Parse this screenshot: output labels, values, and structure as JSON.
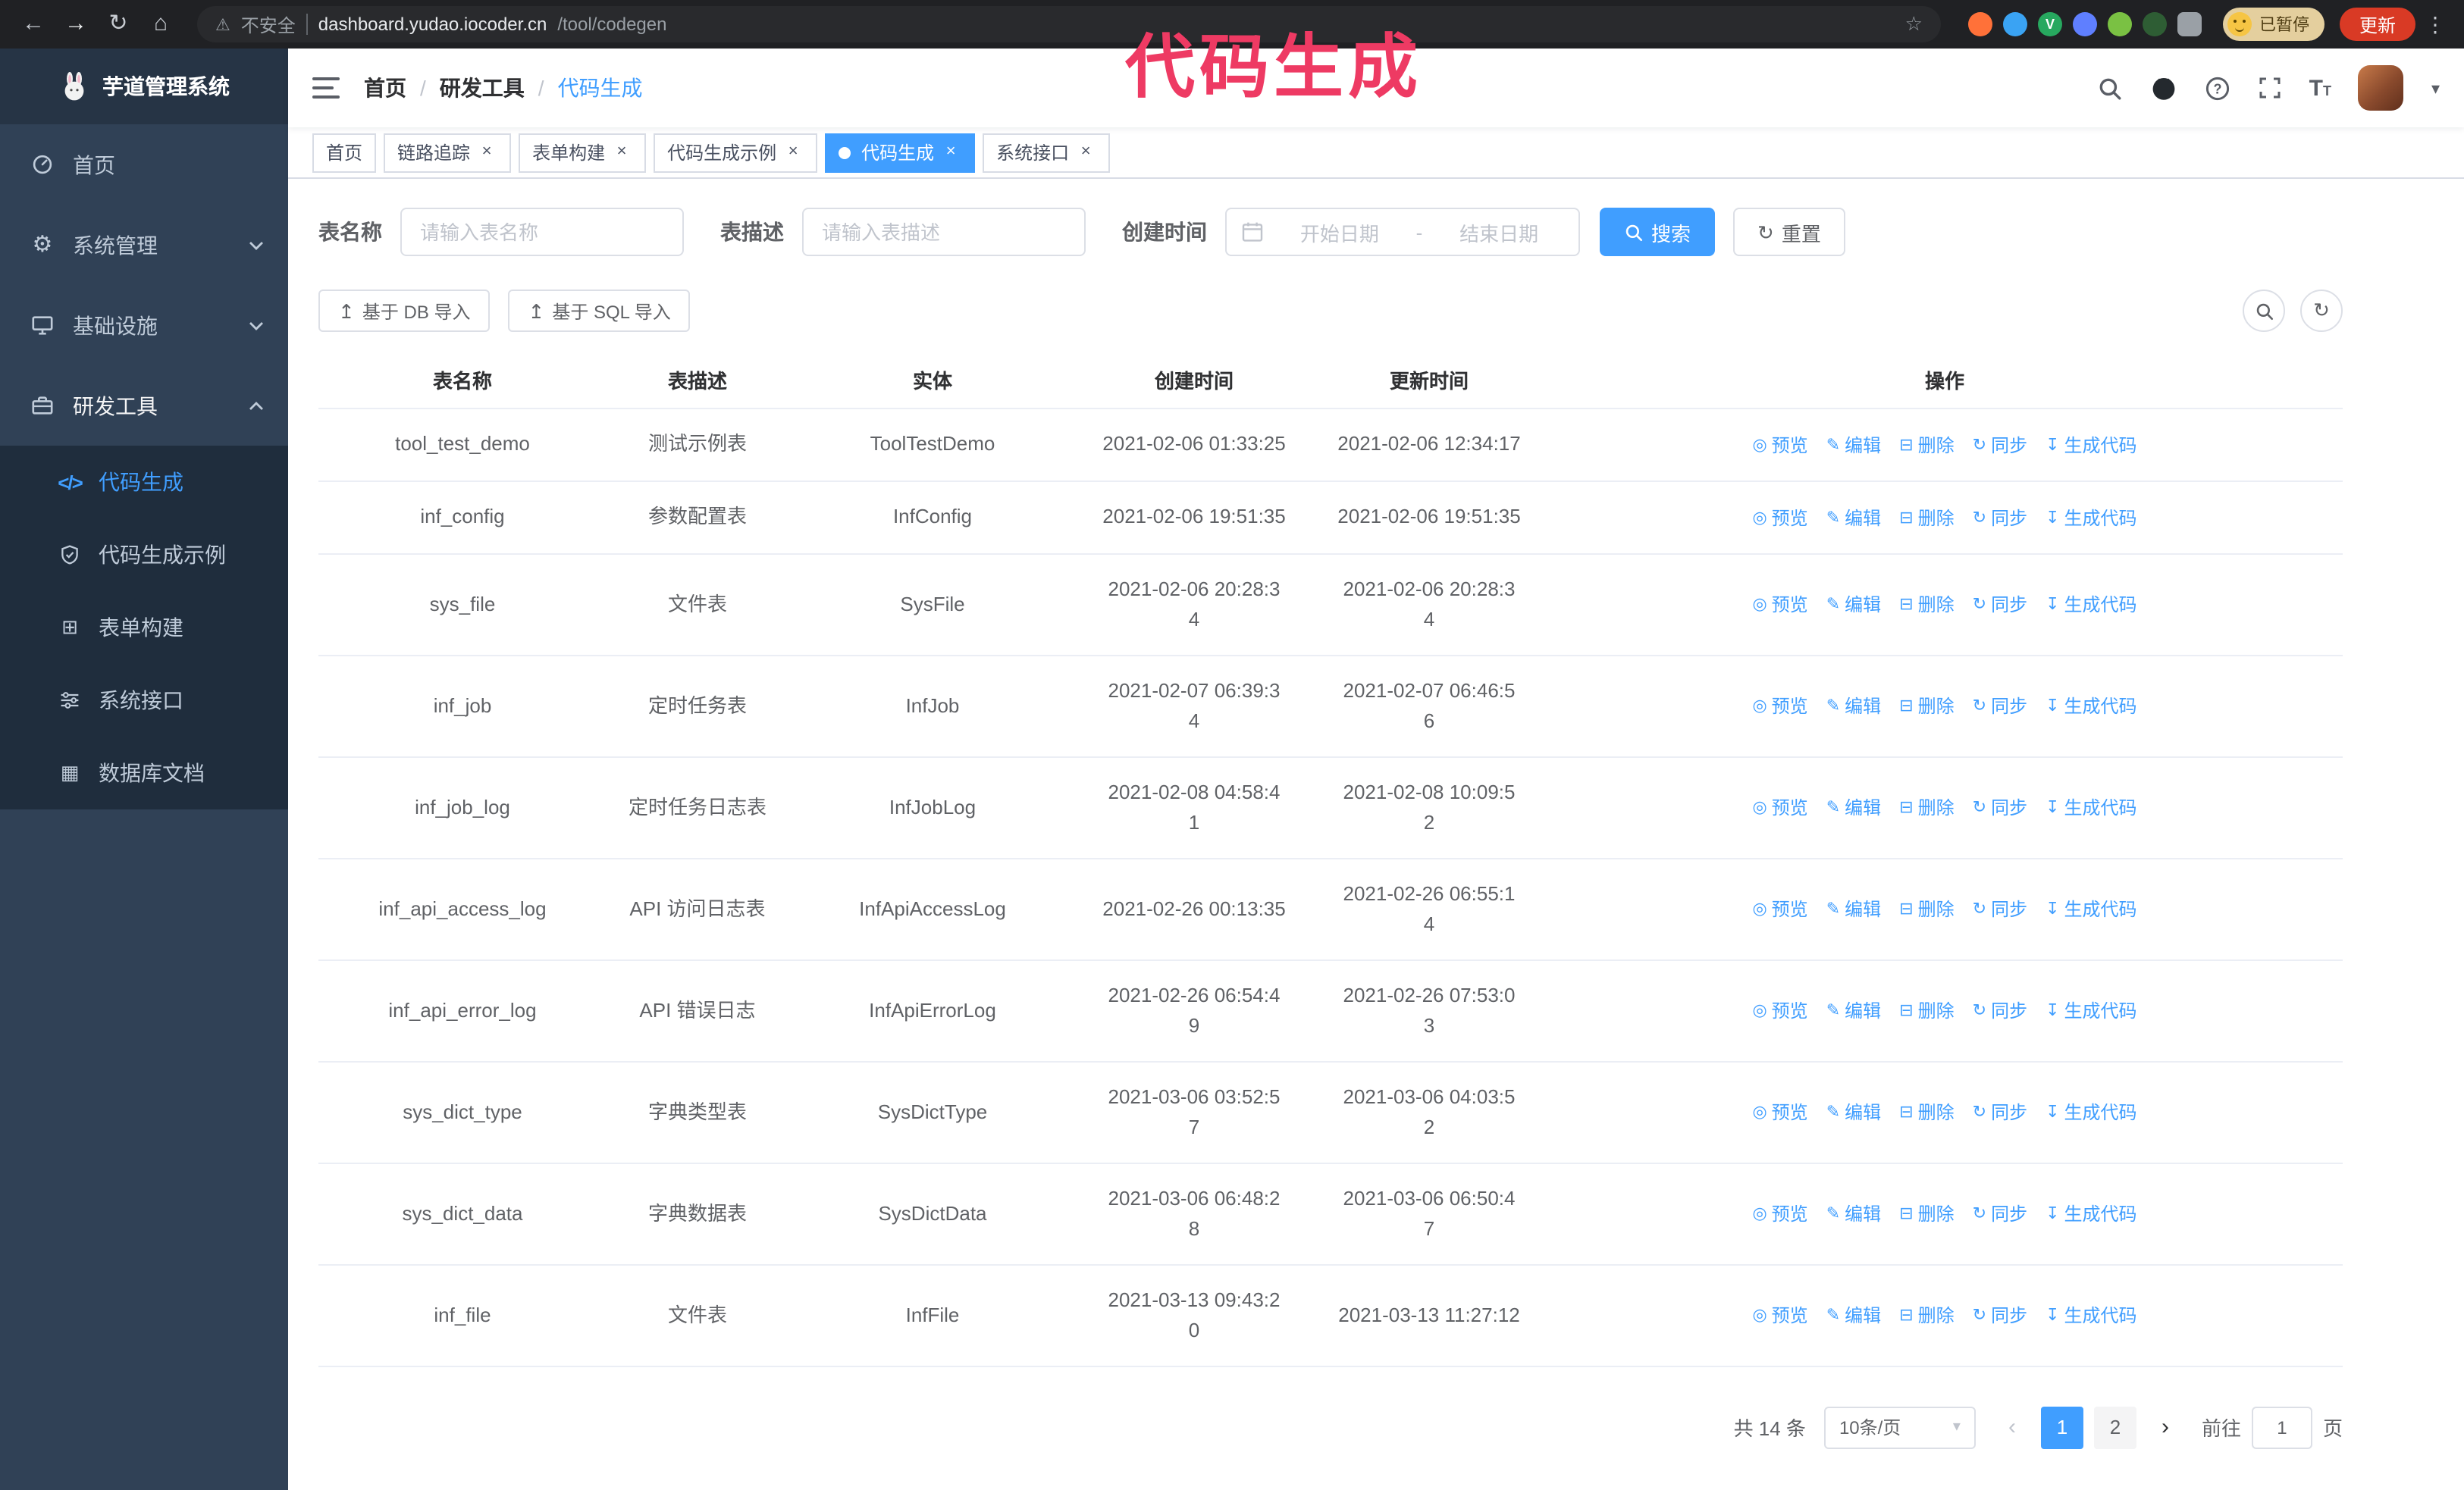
{
  "colors": {
    "accent": "#409eff",
    "annotation": "#ee3a63",
    "sidebar_bg": "#304156",
    "submenu_bg": "#1f2d3d",
    "update_button_bg": "#d93a25"
  },
  "annotation": {
    "text": "代码生成"
  },
  "ui": {
    "back_glyph": "←",
    "forward_glyph": "→",
    "reload_glyph": "↻",
    "home_glyph": "⌂",
    "star_glyph": "☆",
    "kebab_glyph": "⋮",
    "warning_glyph": "⚠",
    "close_glyph": "×",
    "caret_glyph": "▾",
    "breadcrumb_sep": "/",
    "prev_glyph": "‹",
    "next_glyph": "›",
    "upload_glyph": "↥",
    "refresh_glyph": "↻",
    "ext_check_letter": "V"
  },
  "browser": {
    "security_label": "不安全",
    "url_host": "dashboard.yudao.iocoder.cn",
    "url_path": "/tool/codegen",
    "paused_badge": "已暂停",
    "update_button": "更新"
  },
  "sidebar": {
    "logo_title": "芋道管理系统",
    "menu": [
      {
        "label": "首页",
        "icon": "dashboard-icon"
      },
      {
        "label": "系统管理",
        "icon": "gear-icon",
        "glyph": "⚙"
      },
      {
        "label": "基础设施",
        "icon": "monitor-icon"
      },
      {
        "label": "研发工具",
        "icon": "toolbox-icon"
      }
    ],
    "submenu": [
      {
        "label": "代码生成",
        "icon": "code-icon",
        "glyph": "</>"
      },
      {
        "label": "代码生成示例",
        "icon": "example-icon"
      },
      {
        "label": "表单构建",
        "icon": "form-builder-icon",
        "glyph": "⊞"
      },
      {
        "label": "系统接口",
        "icon": "api-icon"
      },
      {
        "label": "数据库文档",
        "icon": "database-icon",
        "glyph": "▦"
      }
    ]
  },
  "navbar": {
    "breadcrumb": [
      "首页",
      "研发工具",
      "代码生成"
    ]
  },
  "tabs": [
    {
      "label": "首页"
    },
    {
      "label": "链路追踪"
    },
    {
      "label": "表单构建"
    },
    {
      "label": "代码生成示例"
    },
    {
      "label": "代码生成",
      "active": true
    },
    {
      "label": "系统接口"
    }
  ],
  "filters": {
    "table_name_label": "表名称",
    "table_name_placeholder": "请输入表名称",
    "table_desc_label": "表描述",
    "table_desc_placeholder": "请输入表描述",
    "create_time_label": "创建时间",
    "start_date_placeholder": "开始日期",
    "date_separator": "-",
    "end_date_placeholder": "结束日期",
    "search_button": "搜索",
    "reset_button": "重置"
  },
  "toolbar": {
    "import_db_label": "基于 DB 导入",
    "import_sql_label": "基于 SQL 导入"
  },
  "table": {
    "columns": [
      "表名称",
      "表描述",
      "实体",
      "创建时间",
      "更新时间",
      "操作"
    ],
    "actions": [
      {
        "label": "预览",
        "name": "preview-action",
        "icon": "eye-icon",
        "glyph": "◎"
      },
      {
        "label": "编辑",
        "name": "edit-action",
        "icon": "edit-icon",
        "glyph": "✎"
      },
      {
        "label": "删除",
        "name": "delete-action",
        "icon": "delete-icon",
        "glyph": "⊟"
      },
      {
        "label": "同步",
        "name": "sync-action",
        "icon": "sync-icon",
        "glyph": "↻"
      },
      {
        "label": "生成代码",
        "name": "generate-code-action",
        "icon": "download-icon",
        "glyph": "↧"
      }
    ],
    "rows": [
      {
        "name": "tool_test_demo",
        "desc": "测试示例表",
        "entity": "ToolTestDemo",
        "created": "2021-02-06 01:33:25",
        "updated": "2021-02-06 12:34:17"
      },
      {
        "name": "inf_config",
        "desc": "参数配置表",
        "entity": "InfConfig",
        "created": "2021-02-06 19:51:35",
        "updated": "2021-02-06 19:51:35"
      },
      {
        "name": "sys_file",
        "desc": "文件表",
        "entity": "SysFile",
        "created": "2021-02-06 20:28:3\n4",
        "updated": "2021-02-06 20:28:3\n4"
      },
      {
        "name": "inf_job",
        "desc": "定时任务表",
        "entity": "InfJob",
        "created": "2021-02-07 06:39:3\n4",
        "updated": "2021-02-07 06:46:5\n6"
      },
      {
        "name": "inf_job_log",
        "desc": "定时任务日志表",
        "entity": "InfJobLog",
        "created": "2021-02-08 04:58:4\n1",
        "updated": "2021-02-08 10:09:5\n2"
      },
      {
        "name": "inf_api_access_log",
        "desc": "API 访问日志表",
        "entity": "InfApiAccessLog",
        "created": "2021-02-26 00:13:35",
        "updated": "2021-02-26 06:55:1\n4"
      },
      {
        "name": "inf_api_error_log",
        "desc": "API 错误日志",
        "entity": "InfApiErrorLog",
        "created": "2021-02-26 06:54:4\n9",
        "updated": "2021-02-26 07:53:0\n3"
      },
      {
        "name": "sys_dict_type",
        "desc": "字典类型表",
        "entity": "SysDictType",
        "created": "2021-03-06 03:52:5\n7",
        "updated": "2021-03-06 04:03:5\n2"
      },
      {
        "name": "sys_dict_data",
        "desc": "字典数据表",
        "entity": "SysDictData",
        "created": "2021-03-06 06:48:2\n8",
        "updated": "2021-03-06 06:50:4\n7"
      },
      {
        "name": "inf_file",
        "desc": "文件表",
        "entity": "InfFile",
        "created": "2021-03-13 09:43:2\n0",
        "updated": "2021-03-13 11:27:12"
      }
    ]
  },
  "pagination": {
    "total": "共 14 条",
    "page_size": "10条/页",
    "pages": [
      "1",
      "2"
    ],
    "active_page": "1",
    "goto_label": "前往",
    "goto_value": "1",
    "page_suffix": "页"
  }
}
